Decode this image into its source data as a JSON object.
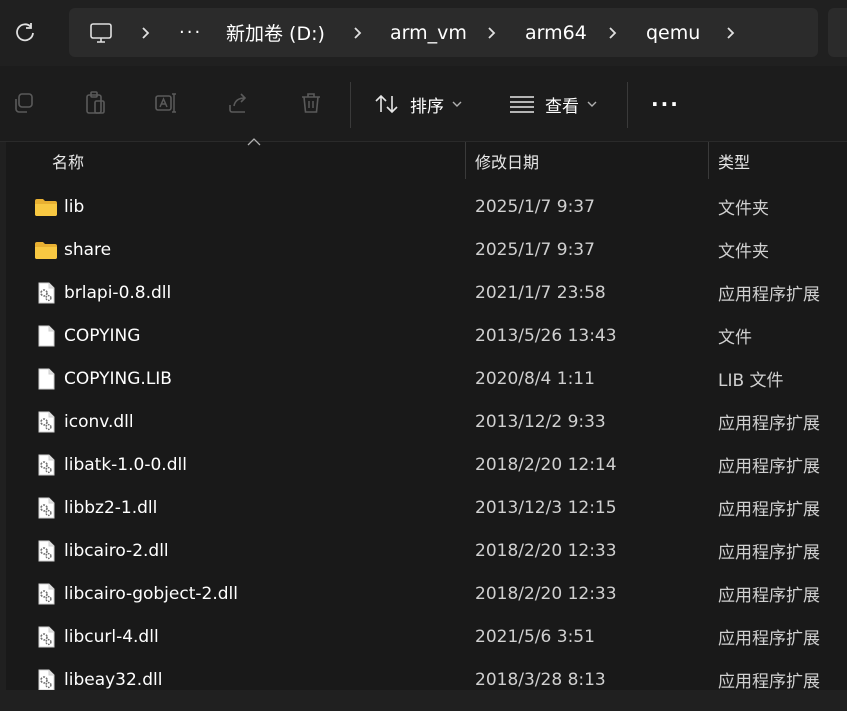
{
  "address_bar": {
    "segments": [
      "新加卷 (D:)",
      "arm_vm",
      "arm64",
      "qemu"
    ],
    "more": "···"
  },
  "toolbar": {
    "sort_label": "排序",
    "view_label": "查看",
    "more": "···"
  },
  "columns": {
    "name": "名称",
    "date": "修改日期",
    "type": "类型"
  },
  "files": [
    {
      "name": "lib",
      "date": "2025/1/7 9:37",
      "type": "文件夹",
      "icon": "folder-icon"
    },
    {
      "name": "share",
      "date": "2025/1/7 9:37",
      "type": "文件夹",
      "icon": "folder-icon"
    },
    {
      "name": "brlapi-0.8.dll",
      "date": "2021/1/7 23:58",
      "type": "应用程序扩展",
      "icon": "dll-file-icon"
    },
    {
      "name": "COPYING",
      "date": "2013/5/26 13:43",
      "type": "文件",
      "icon": "file-icon"
    },
    {
      "name": "COPYING.LIB",
      "date": "2020/8/4 1:11",
      "type": "LIB 文件",
      "icon": "file-icon"
    },
    {
      "name": "iconv.dll",
      "date": "2013/12/2 9:33",
      "type": "应用程序扩展",
      "icon": "dll-file-icon"
    },
    {
      "name": "libatk-1.0-0.dll",
      "date": "2018/2/20 12:14",
      "type": "应用程序扩展",
      "icon": "dll-file-icon"
    },
    {
      "name": "libbz2-1.dll",
      "date": "2013/12/3 12:15",
      "type": "应用程序扩展",
      "icon": "dll-file-icon"
    },
    {
      "name": "libcairo-2.dll",
      "date": "2018/2/20 12:33",
      "type": "应用程序扩展",
      "icon": "dll-file-icon"
    },
    {
      "name": "libcairo-gobject-2.dll",
      "date": "2018/2/20 12:33",
      "type": "应用程序扩展",
      "icon": "dll-file-icon"
    },
    {
      "name": "libcurl-4.dll",
      "date": "2021/5/6 3:51",
      "type": "应用程序扩展",
      "icon": "dll-file-icon"
    },
    {
      "name": "libeay32.dll",
      "date": "2018/3/28 8:13",
      "type": "应用程序扩展",
      "icon": "dll-file-icon"
    }
  ],
  "colors": {
    "background": "#191919",
    "folder": "#f8c842",
    "icon_disabled": "#5a5a5a"
  }
}
